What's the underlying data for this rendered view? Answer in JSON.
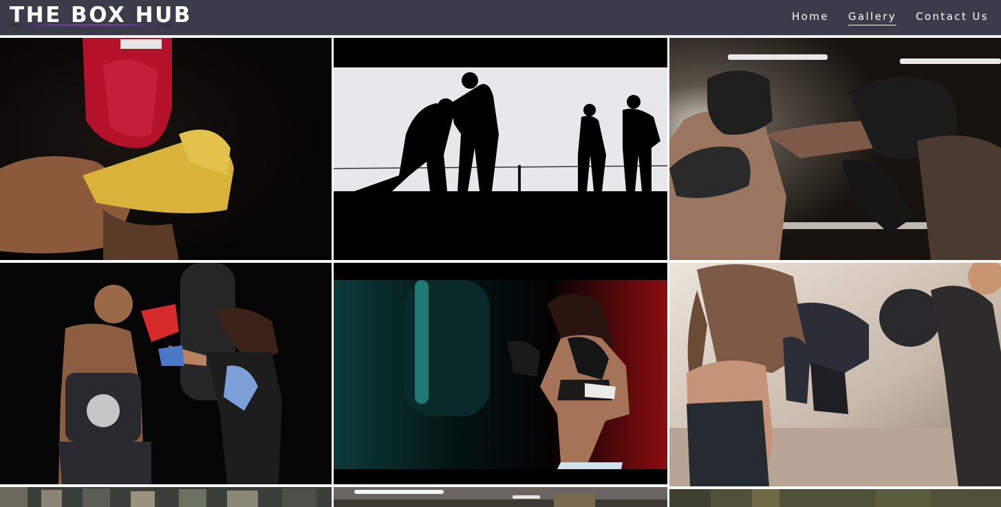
{
  "brand": {
    "title": "THE BOX HUB"
  },
  "nav": {
    "items": [
      {
        "label": "Home",
        "active": false
      },
      {
        "label": "Gallery",
        "active": true
      },
      {
        "label": "Contact Us",
        "active": false
      }
    ]
  },
  "colors": {
    "navbar_bg": "#3a3d49",
    "brand_underline": "#7a36b0",
    "page_bg": "#ffffff"
  },
  "gallery": {
    "images": [
      {
        "name": "boxer-red-headgear-yellow-wraps"
      },
      {
        "name": "sparring-silhouettes"
      },
      {
        "name": "ring-sparring-headgear"
      },
      {
        "name": "trainer-pads-female-boxer"
      },
      {
        "name": "female-boxer-heavy-bag-teal-red"
      },
      {
        "name": "female-boxer-guard-trainer"
      },
      {
        "name": "crowd-arena"
      },
      {
        "name": "gym-interior"
      },
      {
        "name": "gym-green-wall"
      }
    ]
  }
}
